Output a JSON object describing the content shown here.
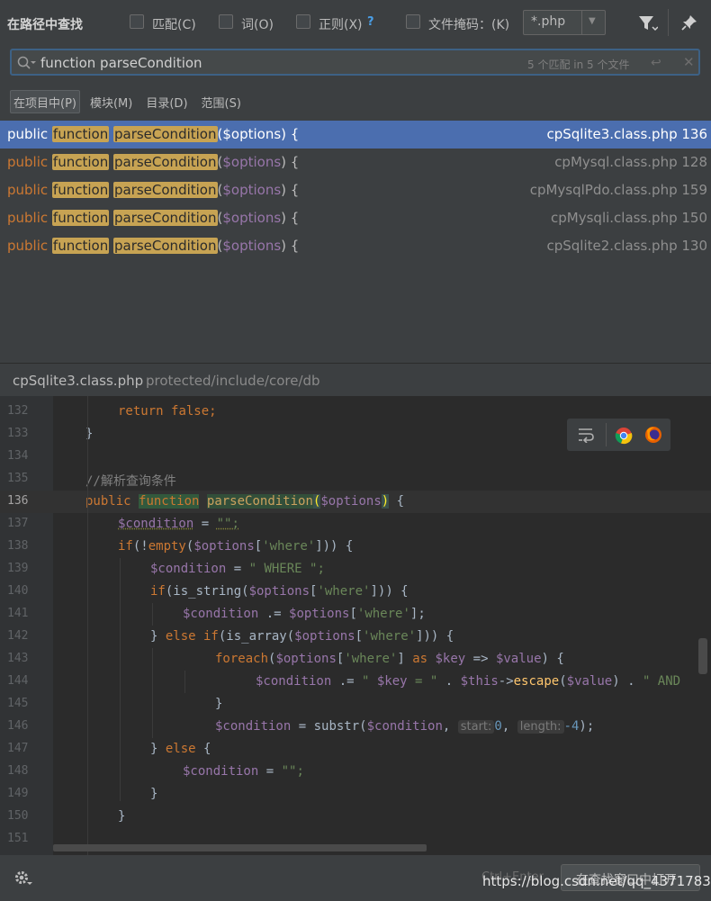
{
  "header": {
    "title": "在路径中查找",
    "options": [
      {
        "label": "匹配(C)"
      },
      {
        "label": "词(O)"
      },
      {
        "label": "正则(X)"
      },
      {
        "label": "文件掩码：(K)"
      }
    ],
    "regex_help": "?",
    "file_mask_value": "*.php"
  },
  "search": {
    "query": "function parseCondition",
    "match_count": "5 个匹配 in 5 个文件"
  },
  "scopes": [
    {
      "label": "在项目中(P)",
      "active": true
    },
    {
      "label": "模块(M)"
    },
    {
      "label": "目录(D)"
    },
    {
      "label": "范围(S)"
    }
  ],
  "results": [
    {
      "kw": "public",
      "match1": "function",
      "match2": "parseCondition",
      "paren": "(",
      "param": "$options",
      "tail": ") {",
      "file": "cpSqlite3.class.php 136",
      "selected": true
    },
    {
      "kw": "public",
      "match1": "function",
      "match2": "parseCondition",
      "paren": "(",
      "param": "$options",
      "tail": ") {",
      "file": "cpMysql.class.php 128"
    },
    {
      "kw": "public",
      "match1": "function",
      "match2": "parseCondition",
      "paren": "(",
      "param": "$options",
      "tail": ") {",
      "file": "cpMysqlPdo.class.php 159"
    },
    {
      "kw": "public",
      "match1": "function",
      "match2": "parseCondition",
      "paren": "(",
      "param": "$options",
      "tail": ") {",
      "file": "cpMysqli.class.php 150"
    },
    {
      "kw": "public",
      "match1": "function",
      "match2": "parseCondition",
      "paren": "(",
      "param": "$options",
      "tail": ") {",
      "file": "cpSqlite2.class.php 130"
    }
  ],
  "preview": {
    "file_name": "cpSqlite3.class.php",
    "file_path": "protected/include/core/db",
    "line_numbers": [
      "132",
      "133",
      "134",
      "135",
      "136",
      "137",
      "138",
      "139",
      "140",
      "141",
      "142",
      "143",
      "144",
      "145",
      "146",
      "147",
      "148",
      "149",
      "150",
      "151"
    ],
    "current_line": "136",
    "code": {
      "l132_kw": "return",
      "l132_val": "false",
      "l133": "}",
      "l135_comment": "//解析查询条件",
      "l136_kw1": "public",
      "l136_kw2": "function",
      "l136_name": "parseCondition",
      "l136_var": "$options",
      "l136_end": ") {",
      "l137_var": "$condition",
      "l137_op": " = ",
      "l137_str": "\"\";",
      "l138_kw": "if",
      "l138_a": "(!",
      "l138_fn": "empty",
      "l138_var": "$options",
      "l138_str": "'where'",
      "l138_end": "])) {",
      "l139_var": "$condition",
      "l139_str": "\" WHERE \";",
      "l140_kw": "if",
      "l140_fn": "(is_string(",
      "l140_var": "$options",
      "l140_str": "'where'",
      "l140_end": "])) {",
      "l141_var": "$condition",
      "l141_op": " .= ",
      "l141_var2": "$options",
      "l141_str": "'where'",
      "l141_end": "];",
      "l142_a": "} ",
      "l142_kw": "else if",
      "l142_fn": "(is_array(",
      "l142_var": "$options",
      "l142_str": "'where'",
      "l142_end": "])) {",
      "l143_kw": "foreach",
      "l143_var": "$options",
      "l143_str": "'where'",
      "l143_as": "as",
      "l143_key": "$key",
      "l143_arrow": " => ",
      "l143_val": "$value",
      "l143_end": ") {",
      "l144_var": "$condition",
      "l144_op": " .= ",
      "l144_s1": "\" ",
      "l144_key": "$key",
      "l144_s2": " = \"",
      "l144_dot": " . ",
      "l144_this": "$this",
      "l144_arrow": "->",
      "l144_fn": "escape",
      "l144_val": "$value",
      "l144_end": ") . ",
      "l144_s3": "\" AND",
      "l145": "}",
      "l146_var": "$condition",
      "l146_op": " = substr(",
      "l146_var2": "$condition",
      "l146_hint1": "start:",
      "l146_n1": "0",
      "l146_hint2": "length:",
      "l146_n2": "-4",
      "l146_end": ");",
      "l147_a": "} ",
      "l147_kw": "else",
      "l147_end": " {",
      "l148_var": "$condition",
      "l148_op": " = ",
      "l148_str": "\"\";",
      "l149": "}",
      "l150": "}"
    }
  },
  "footer": {
    "shortcut": "Ctrl+Enter",
    "open_button": "在查找窗口中打开"
  },
  "watermark": "https://blog.csdn.net/qq_43717836"
}
